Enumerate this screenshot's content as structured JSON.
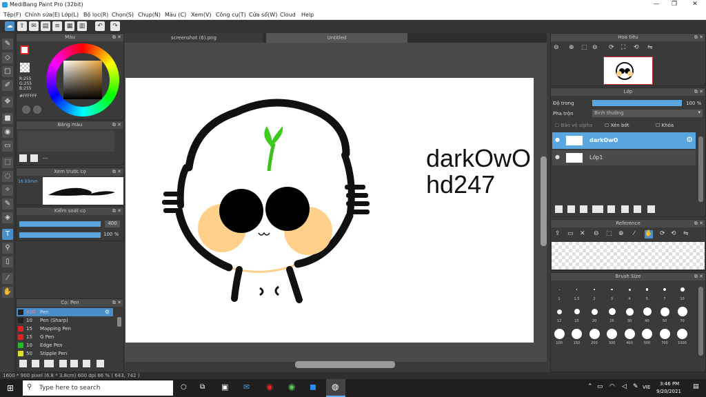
{
  "window": {
    "title": "MediBang Paint Pro (32bit)"
  },
  "menu": [
    "Tệp(F)",
    "Chỉnh sửa(E)",
    "Lớp(L)",
    "Bộ lọc(R)",
    "Chọn(S)",
    "Chụp(N)",
    "Màu (C)",
    "Xem(V)",
    "Công cụ(T)",
    "Cửa sổ(W)",
    "Cloud",
    "Help"
  ],
  "tabs": {
    "tab1": "screenshot (6).png",
    "tab2": "Untitled"
  },
  "color_panel": {
    "title": "Màu",
    "r": "R:255",
    "g": "G:255",
    "b": "B:255",
    "hex": "#FFFFFF"
  },
  "palette_panel": {
    "title": "Bảng màu",
    "dash": "---"
  },
  "preview_panel": {
    "title": "Xem trước cọ",
    "size": "16.93mm"
  },
  "control_panel": {
    "title": "Kiểm soát cọ",
    "size": "400",
    "opacity": "100 %"
  },
  "brush_panel": {
    "title": "Cọ: Pen",
    "items": [
      {
        "size": "400",
        "name": "Pen",
        "color": "#222"
      },
      {
        "size": "10",
        "name": "Pen (Sharp)",
        "color": "#222"
      },
      {
        "size": "15",
        "name": "Mapping Pen",
        "color": "#d22"
      },
      {
        "size": "15",
        "name": "G Pen",
        "color": "#d22"
      },
      {
        "size": "10",
        "name": "Edge Pen",
        "color": "#2b2"
      },
      {
        "size": "50",
        "name": "Stipple Pen",
        "color": "#dd2"
      }
    ]
  },
  "navigator": {
    "title": "Hoa tiêu"
  },
  "layers_panel": {
    "title": "Lớp",
    "opacity_label": "Độ trong",
    "opacity_value": "100 %",
    "blend_label": "Pha trộn",
    "blend_value": "Bình thường",
    "protect_alpha": "Bảo vệ alpha",
    "clipping": "Xén bớt",
    "lock": "Khóa",
    "layers": [
      {
        "name": "darkOwO",
        "active": true
      },
      {
        "name": "Lớp1",
        "active": false
      }
    ]
  },
  "reference_panel": {
    "title": "Reference"
  },
  "brush_size_panel": {
    "title": "Brush Size",
    "sizes": [
      "1",
      "1.5",
      "2",
      "3",
      "4",
      "5",
      "7",
      "10",
      "12",
      "15",
      "20",
      "25",
      "30",
      "40",
      "50",
      "70",
      "100",
      "150",
      "200",
      "300",
      "400",
      "500",
      "700",
      "1000"
    ]
  },
  "canvas": {
    "text1": "darkOwO",
    "text2": "hd247"
  },
  "status": {
    "text": "1600 * 900 pixel   (6.8 * 3.8cm)   600 dpi   66 %   ( 643, 742 )"
  },
  "taskbar": {
    "search": "Type here to search",
    "lang": "VIE",
    "time": "3:46 PM",
    "date": "9/20/2021"
  }
}
